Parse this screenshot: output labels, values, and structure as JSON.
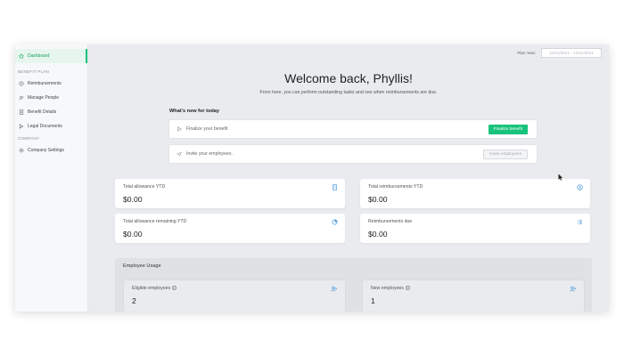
{
  "sidebar": {
    "items": [
      {
        "label": "Dashboard",
        "icon": "home-icon",
        "active": true
      },
      {
        "section": "BENEFIT PLAN"
      },
      {
        "label": "Reimbursements",
        "icon": "receipt-icon"
      },
      {
        "label": "Manage People",
        "icon": "people-icon"
      },
      {
        "label": "Benefit Details",
        "icon": "document-icon"
      },
      {
        "label": "Legal Documents",
        "icon": "legal-icon"
      },
      {
        "section": "COMPANY"
      },
      {
        "label": "Company Settings",
        "icon": "gear-icon"
      }
    ]
  },
  "header": {
    "plan_year_label": "Plan Year:",
    "plan_year_range": "11/01/2021 - 12/31/2021"
  },
  "main": {
    "welcome": "Welcome back, Phyllis!",
    "subtitle": "From here, you can perform outstanding tasks and see when reimbursements are due.",
    "whats_new": "What's new for today",
    "tasks": [
      {
        "text": "Finalize your benefit",
        "button": "Finalize benefit",
        "icon": "play-icon"
      },
      {
        "text": "Invite your employees.",
        "button": "Invite employees",
        "icon": "paper-plane-icon"
      }
    ],
    "stats": [
      {
        "label": "Total allowance YTD",
        "value": "$0.00",
        "icon": "calculator-icon"
      },
      {
        "label": "Total reimbursements YTD",
        "value": "$0.00",
        "icon": "dollar-icon"
      },
      {
        "label": "Total allowance remaining YTD",
        "value": "$0.00",
        "icon": "pie-chart-icon"
      },
      {
        "label": "Reimbursements due",
        "value": "$0.00",
        "icon": "list-icon"
      }
    ],
    "usage": {
      "title": "Employee Usage",
      "cards": [
        {
          "label": "Eligible employees",
          "value": "2",
          "icon": "add-user-icon"
        },
        {
          "label": "New employees",
          "value": "1",
          "icon": "add-user-icon"
        }
      ]
    }
  },
  "colors": {
    "accent": "#19c37d",
    "background": "#e9ebee"
  }
}
